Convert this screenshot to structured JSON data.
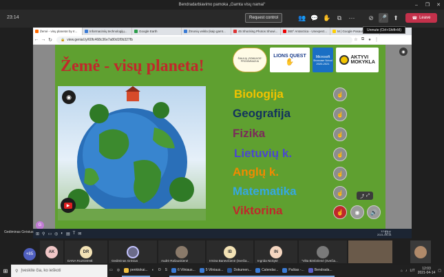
{
  "window": {
    "title": "Bendradarbiavimo pamoka „Gamta visų namai“",
    "controls": [
      "–",
      "❐",
      "✕"
    ]
  },
  "teams": {
    "timer": "23:14",
    "request_control": "Request control",
    "leave": "Leave",
    "tooltip": "Unmute (Ctrl+Shift+M)"
  },
  "browser": {
    "tabs": [
      {
        "label": "Žemė - visų planeta! by Ir...",
        "color": "#ff6a00",
        "active": true
      },
      {
        "label": "Informaciniių technologijų...",
        "color": "#3a7bd5",
        "active": false
      },
      {
        "label": "Google Earth",
        "color": "#2a9d4a",
        "active": false
      },
      {
        "label": "Žmonių veikla (kaip gamt...",
        "color": "#3a7bd5",
        "active": false
      },
      {
        "label": "45 Shocking Photos Showi...",
        "color": "#d33",
        "active": false
      },
      {
        "label": "360° Antarctica - Unexpect...",
        "color": "#e00",
        "active": false
      },
      {
        "label": "M | Google Pasaulinis rai...",
        "color": "#ffcf00",
        "active": false
      }
    ],
    "url": "view.genial.ly/60fc468c36e7a80d1f0b327fb"
  },
  "slide": {
    "title": "Žemė - visų planeta!",
    "logos": {
      "school": "ŠIAULIŲ „ROMUVOS“ PROGIMNAZIJA",
      "lions": "LIONS QUEST",
      "ms_line1": "Microsoft",
      "ms_line2": "Showcase School",
      "ms_line3": "2020-2021",
      "active": "AKTYVI MOKYKLA"
    },
    "subjects": [
      {
        "label": "Biologija",
        "color": "#f2c200"
      },
      {
        "label": "Geografija",
        "color": "#12325e"
      },
      {
        "label": "Fizika",
        "color": "#7b2b5a"
      },
      {
        "label": "Lietuvių k.",
        "color": "#4b47d0"
      },
      {
        "label": "Anglų k.",
        "color": "#f28a00"
      },
      {
        "label": "Matematika",
        "color": "#36a8e0"
      },
      {
        "label": "Viktorina",
        "color": "#c0282b"
      }
    ]
  },
  "inner_taskbar": {
    "presenter": "Gediminas Grėsius",
    "time": "12:03",
    "date": "2021-04-14",
    "lang": "LIT"
  },
  "participants": {
    "more": "+85",
    "people": [
      {
        "initials": "AK",
        "name": "",
        "color": "#f1c7c7"
      },
      {
        "initials": "DR",
        "name": "DANA RUZGIENĖ",
        "color": "#f3e2b5"
      },
      {
        "initials": "",
        "name": "Gediminas Grėsius",
        "color": "#6b6b8a"
      },
      {
        "initials": "",
        "name": "Audrė Rašauskienė",
        "color": "#8a7a6a"
      },
      {
        "initials": "IB",
        "name": "Irmina Banevičienė (Svečia...",
        "color": "#f3e2b5"
      },
      {
        "initials": "IN",
        "name": "Ingrida Nickytė",
        "color": "#f5d6c0"
      },
      {
        "initials": "",
        "name": "\"Vilta Bimbirienė (Svečia...",
        "color": "#7a7a7a"
      }
    ]
  },
  "taskbar": {
    "search": "Įveskite čia, ko ieškoti",
    "apps": [
      {
        "label": "penktokai...",
        "color": "#f0c040"
      },
      {
        "label": "6 Vilniaus...",
        "color": "#3a7bd5"
      },
      {
        "label": "5 Vilniaus...",
        "color": "#3a7bd5"
      },
      {
        "label": "Dokumen...",
        "color": "#2b5797"
      },
      {
        "label": "Calendar...",
        "color": "#3a7bd5"
      },
      {
        "label": "Paštas -...",
        "color": "#3a7bd5"
      },
      {
        "label": "Bendrada...",
        "color": "#5b5fc7"
      }
    ],
    "lang": "LIT",
    "time": "12:03",
    "date": "2021-04-14"
  }
}
